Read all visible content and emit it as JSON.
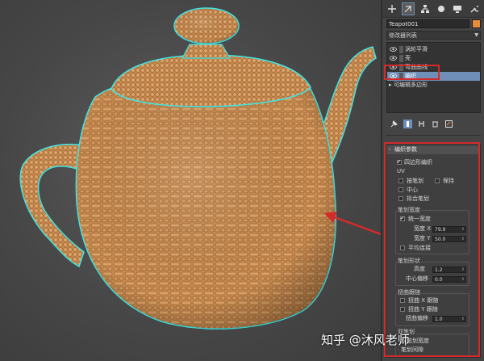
{
  "object": {
    "name": "Teapot001",
    "color": "#e88b3a"
  },
  "modifier_list": {
    "label": "修改器列表"
  },
  "stack": {
    "items": [
      {
        "label": "涡轮平滑"
      },
      {
        "label": "壳"
      },
      {
        "label": "弯曲曲线"
      },
      {
        "label": "编织"
      }
    ],
    "base_label": "可编辑多边形",
    "selected_index": 3
  },
  "toolbar": {
    "icons": [
      "plus-icon",
      "modify-icon",
      "hierarchy-icon",
      "motion-icon",
      "display-icon",
      "utilities-icon"
    ]
  },
  "rollout": {
    "title": "编织参数",
    "quad_weave": "四边形编织",
    "uv_label": "UV",
    "by_stroke": "按笔划",
    "keep": "保持",
    "center": "中心",
    "fit_stroke": "拟合笔划",
    "stroke_width_label": "笔划宽度",
    "uniform_width": "统一宽度",
    "width_x_label": "宽度 X",
    "width_x_value": "79.9",
    "width_y_label": "宽度 Y",
    "width_y_value": "50.0",
    "smooth_connect": "平均连接",
    "stroke_shape_label": "笔划形状",
    "height_label": "高度",
    "height_value": "1.2",
    "center_offset_label": "中心偏移",
    "center_offset_value": "0.0",
    "twist_label": "扭曲跟随",
    "twist_x": "扭曲 X 跟随",
    "twist_y": "扭曲 Y 跟随",
    "twist_offset_label": "扭曲偏移",
    "twist_offset_value": "1.0",
    "double_stroke_label": "双笔划",
    "double_stroke_width": "双笔划宽度",
    "double_stroke_gap": "笔划间隙"
  },
  "watermark": "知乎 @沐风老师"
}
